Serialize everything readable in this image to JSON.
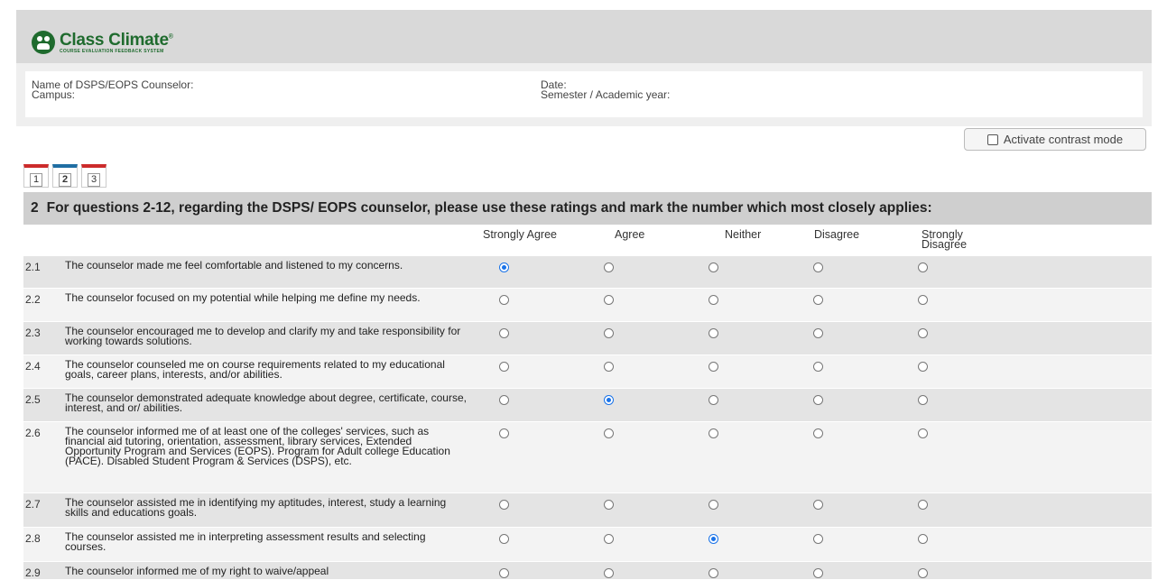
{
  "brand": {
    "title": "Class Climate",
    "mark": "®",
    "subtitle": "COURSE EVALUATION FEEDBACK SYSTEM",
    "color": "#1f6b2e"
  },
  "info": {
    "counselor_label": "Name of DSPS/EOPS Counselor:",
    "campus_label": "Campus:",
    "date_label": "Date:",
    "semester_label": "Semester / Academic year:"
  },
  "contrast_button": {
    "label": "Activate contrast mode"
  },
  "tabs": [
    {
      "label": "1",
      "active": false
    },
    {
      "label": "2",
      "active": true
    },
    {
      "label": "3",
      "active": false
    }
  ],
  "section": {
    "number": "2",
    "title": "For questions 2-12, regarding the DSPS/ EOPS counselor, please use these ratings and mark the number which most closely applies:"
  },
  "columns": [
    "Strongly Agree",
    "Agree",
    "Neither",
    "Disagree",
    "Strongly Disagree"
  ],
  "questions": [
    {
      "num": "2.1",
      "text": "The counselor made me feel comfortable and listened to my concerns.",
      "selected": 0
    },
    {
      "num": "2.2",
      "text": "The counselor focused on my potential while helping me define my needs.",
      "selected": null
    },
    {
      "num": "2.3",
      "text": "The counselor encouraged me to develop and clarify my and take responsibility for working towards solutions.",
      "selected": null
    },
    {
      "num": "2.4",
      "text": "The counselor counseled me on course requirements related to my educational goals, career plans, interests, and/or abilities.",
      "selected": null
    },
    {
      "num": "2.5",
      "text": "The counselor demonstrated adequate knowledge about degree, certificate, course, interest, and or/ abilities.",
      "selected": 1
    },
    {
      "num": "2.6",
      "text": "The counselor informed me of at least one of the colleges' services, such as financial aid tutoring, orientation, assessment, library services, Extended Opportunity Program and Services (EOPS).  Program for Adult college Education (PACE). Disabled Student Program & Services (DSPS), etc.",
      "selected": null
    },
    {
      "num": "2.7",
      "text": "The counselor assisted me in identifying my aptitudes, interest, study a learning skills and educations goals.",
      "selected": null
    },
    {
      "num": "2.8",
      "text": "The counselor assisted me in interpreting assessment results and selecting courses.",
      "selected": 2
    },
    {
      "num": "2.9",
      "text": "The counselor informed me of my right to waive/appeal",
      "selected": null
    }
  ],
  "colors": {
    "accent": "#1a73e8",
    "tab_red": "#cc2b2b",
    "tab_blue": "#1f6ea3"
  }
}
